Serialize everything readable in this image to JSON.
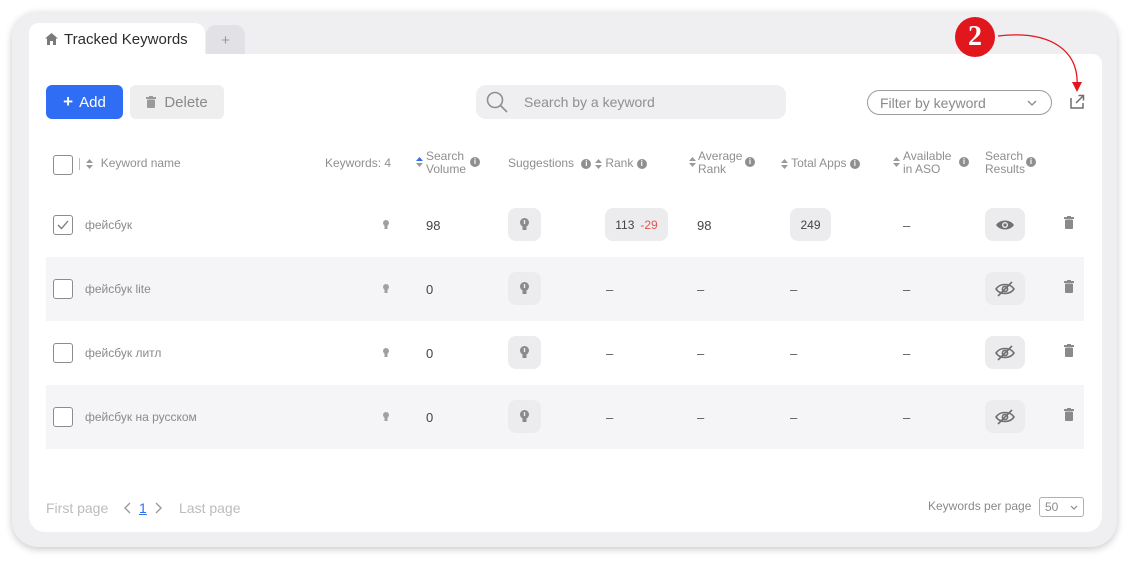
{
  "tabs": {
    "active_label": "Tracked Keywords",
    "add_label": "+"
  },
  "toolbar": {
    "add_label": "Add",
    "delete_label": "Delete"
  },
  "search": {
    "placeholder": "Search by a keyword"
  },
  "filter": {
    "label": "Filter by keyword"
  },
  "annotation": {
    "badge": "2"
  },
  "columns": {
    "keyword_name": "Keyword name",
    "keywords_count": "Keywords: 4",
    "search_volume_1": "Search",
    "search_volume_2": "Volume",
    "suggestions": "Suggestions",
    "rank": "Rank",
    "avg_rank_1": "Average",
    "avg_rank_2": "Rank",
    "total_apps": "Total Apps",
    "available_1": "Available",
    "available_2": "in ASO",
    "results_1": "Search",
    "results_2": "Results"
  },
  "rows": [
    {
      "keyword": "фейсбук",
      "checked": true,
      "volume": "98",
      "rank": "113",
      "rank_change": "-29",
      "avg_rank": "98",
      "total_apps": "249",
      "aso": "–",
      "results_visible": true
    },
    {
      "keyword": "фейсбук lite",
      "checked": false,
      "volume": "0",
      "rank": "–",
      "rank_change": "",
      "avg_rank": "–",
      "total_apps": "–",
      "aso": "–",
      "results_visible": false
    },
    {
      "keyword": "фейсбук литл",
      "checked": false,
      "volume": "0",
      "rank": "–",
      "rank_change": "",
      "avg_rank": "–",
      "total_apps": "–",
      "aso": "–",
      "results_visible": false
    },
    {
      "keyword": "фейсбук на русском",
      "checked": false,
      "volume": "0",
      "rank": "–",
      "rank_change": "",
      "avg_rank": "–",
      "total_apps": "–",
      "aso": "–",
      "results_visible": false
    }
  ],
  "pagination": {
    "first": "First page",
    "current": "1",
    "last": "Last page"
  },
  "per_page": {
    "label": "Keywords per page",
    "value": "50"
  },
  "colors": {
    "primary": "#2f6ef4",
    "negative": "#e65353",
    "annotation": "#e2161d"
  }
}
